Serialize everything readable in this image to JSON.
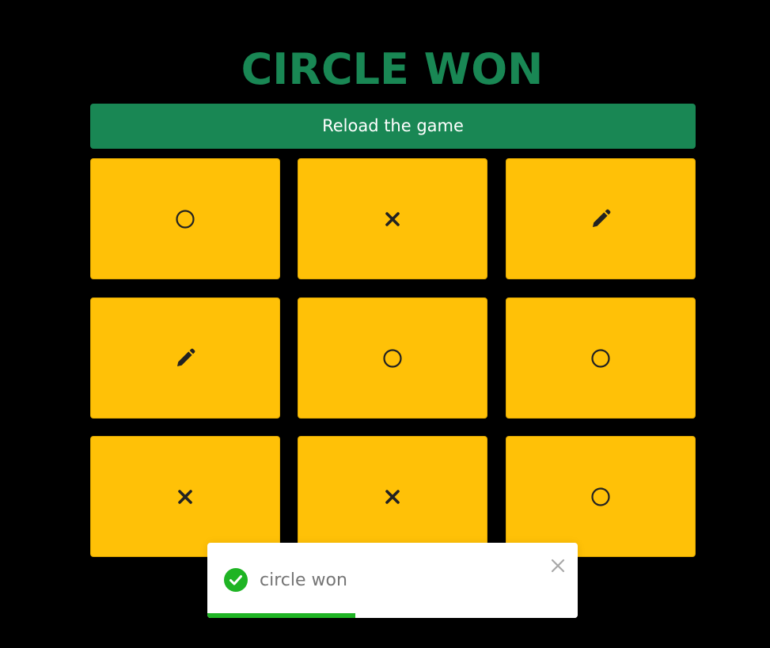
{
  "header": {
    "title": "CIRCLE WON",
    "title_color": "#198754"
  },
  "reload_button": {
    "label": "Reload the game",
    "color": "#198754"
  },
  "board": {
    "cell_color": "#ffc107",
    "cells": [
      [
        "circle",
        "cross",
        "pencil"
      ],
      [
        "pencil",
        "circle",
        "circle"
      ],
      [
        "cross",
        "cross",
        "circle"
      ]
    ]
  },
  "toast": {
    "message": "circle won",
    "icon": "check-circle-icon",
    "icon_color": "#1fb424",
    "progress": 0.4,
    "progress_color": "#1fb424"
  }
}
